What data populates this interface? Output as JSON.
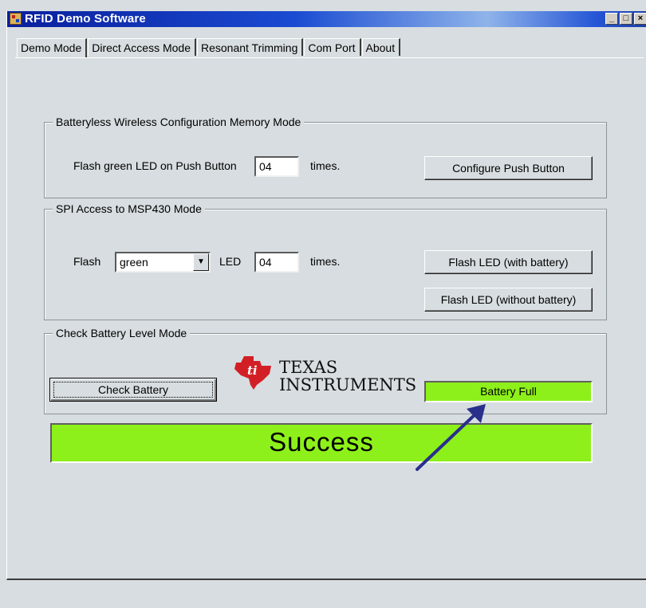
{
  "window": {
    "title": "RFID Demo Software",
    "controls": {
      "minimize": "_",
      "maximize": "□",
      "close": "×"
    }
  },
  "tabs": [
    {
      "label": "Demo Mode",
      "active": true
    },
    {
      "label": "Direct Access Mode",
      "active": false
    },
    {
      "label": "Resonant Trimming",
      "active": false
    },
    {
      "label": "Com Port",
      "active": false
    },
    {
      "label": "About",
      "active": false
    }
  ],
  "batteryless_group": {
    "title": "Batteryless Wireless  Configuration Memory Mode",
    "flash_label": "Flash green LED on Push Button",
    "count_value": "04",
    "times_label": "times.",
    "configure_button": "Configure Push Button"
  },
  "spi_group": {
    "title": "SPI Access to MSP430 Mode",
    "flash_label": "Flash",
    "color_selected": "green",
    "led_label": "LED",
    "count_value": "04",
    "times_label": "times.",
    "flash_with_battery_button": "Flash LED (with battery)",
    "flash_without_battery_button": "Flash LED (without battery)"
  },
  "battery_group": {
    "title": "Check Battery Level Mode",
    "check_button": "Check Battery",
    "logo_line1": "TEXAS",
    "logo_line2": "INSTRUMENTS",
    "status_text": "Battery Full"
  },
  "result_banner": "Success",
  "colors": {
    "status_green": "#8ef01a",
    "titlebar_blue": "#0a1f9c",
    "ti_red": "#d21f26",
    "arrow": "#2a2f8c"
  },
  "icons": {
    "app": "app-icon",
    "dropdown": "dropdown-arrow-icon",
    "annotation": "pointer-arrow-icon"
  }
}
